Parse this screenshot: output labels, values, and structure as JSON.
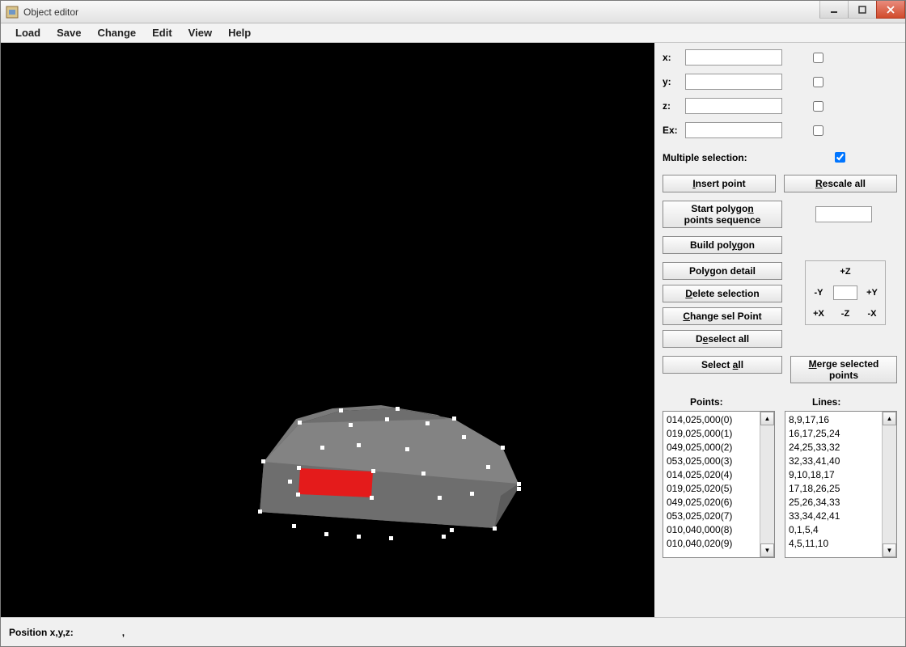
{
  "window": {
    "title": "Object editor"
  },
  "menubar": {
    "items": [
      "Load",
      "Save",
      "Change",
      "Edit",
      "View",
      "Help"
    ]
  },
  "coords": {
    "x_label": "x:",
    "y_label": "y:",
    "z_label": "z:",
    "ex_label": "Ex:",
    "x_value": "",
    "y_value": "",
    "z_value": "",
    "ex_value": ""
  },
  "multiple_selection": {
    "label": "Multiple selection:",
    "checked": true
  },
  "buttons": {
    "insert_point": "Insert point",
    "rescale_all": "Rescale all",
    "start_poly": "Start polygon points sequence",
    "build_polygon": "Build polygon",
    "polygon_detail": "Polygon detail",
    "delete_selection": "Delete selection",
    "change_sel_point": "Change sel Point",
    "deselect_all": "Deselect all",
    "select_all": "Select all",
    "merge_selected": "Merge selected points"
  },
  "nav": {
    "pz": "+Z",
    "my": "-Y",
    "py": "+Y",
    "px": "+X",
    "mz": "-Z",
    "mx": "-X"
  },
  "points_label": "Points:",
  "lines_label": "Lines:",
  "points": [
    "014,025,000(0)",
    "019,025,000(1)",
    "049,025,000(2)",
    "053,025,000(3)",
    "014,025,020(4)",
    "019,025,020(5)",
    "049,025,020(6)",
    "053,025,020(7)",
    "010,040,000(8)",
    "010,040,020(9)"
  ],
  "lines": [
    "8,9,17,16",
    "16,17,25,24",
    "24,25,33,32",
    "32,33,41,40",
    "9,10,18,17",
    "17,18,26,25",
    "25,26,34,33",
    "33,34,42,41",
    "0,1,5,4",
    "4,5,11,10"
  ],
  "status": {
    "label": "Position x,y,z:",
    "value": ","
  }
}
